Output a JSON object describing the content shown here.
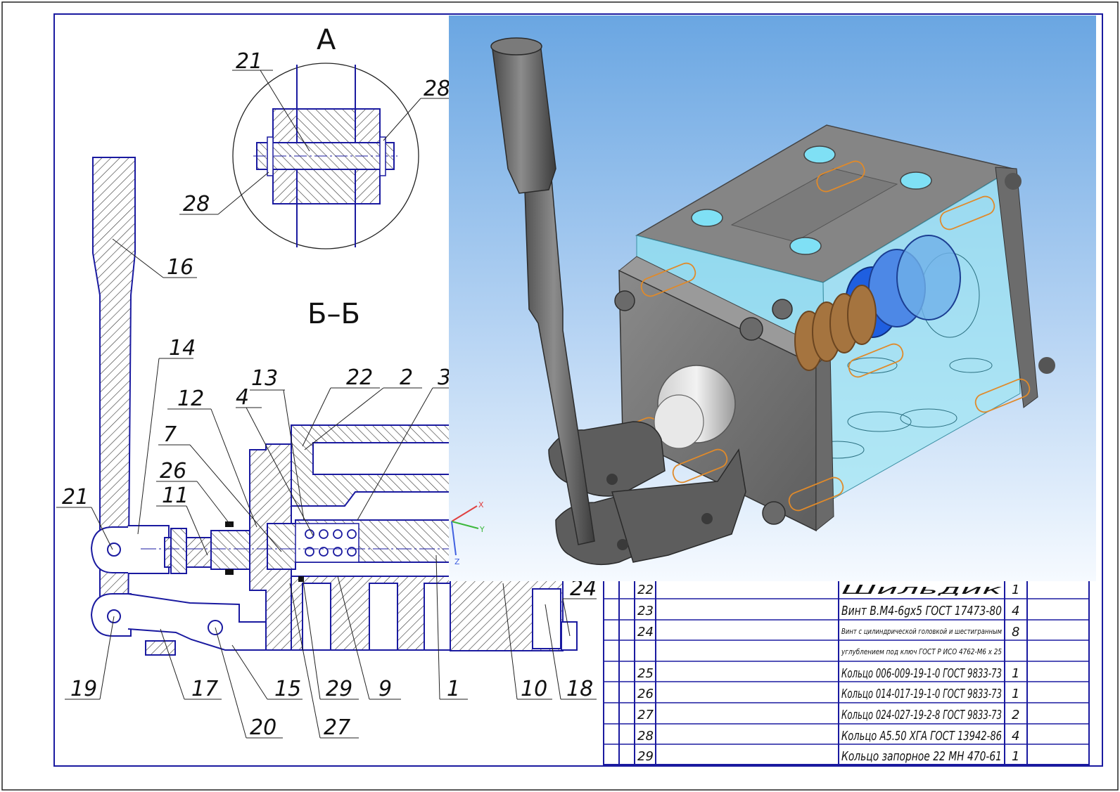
{
  "views": {
    "detail_a": "А",
    "section_bb": "Б–Б"
  },
  "callouts": {
    "n21_top": "21",
    "n28_top": "28",
    "n28_bottom": "28",
    "n16": "16",
    "n14": "14",
    "n13": "13",
    "n22": "22",
    "n2": "2",
    "n3": "3",
    "n12": "12",
    "n4": "4",
    "n7": "7",
    "n26": "26",
    "n11": "11",
    "n21_left": "21",
    "n19": "19",
    "n17": "17",
    "n15": "15",
    "n20": "20",
    "n29": "29",
    "n27": "27",
    "n9": "9",
    "n1": "1",
    "n10": "10",
    "n18": "18",
    "n24": "24"
  },
  "axis_triad": {
    "x": "X",
    "y": "Y",
    "z": "Z"
  },
  "bom": [
    {
      "pos": "22",
      "name": "Шильдик",
      "qty": "1"
    },
    {
      "pos": "23",
      "name": "Винт В.М4-6gx5 ГОСТ 17473-80",
      "qty": "4"
    },
    {
      "pos": "24",
      "name": "Винт с цилиндрической головкой и шестигранным",
      "qty": "8"
    },
    {
      "pos": "",
      "name": "углублением под ключ ГОСТ Р ИСО 4762-М6 х 25",
      "qty": ""
    },
    {
      "pos": "25",
      "name": "Кольцо 006-009-19-1-0 ГОСТ 9833-73",
      "qty": "1"
    },
    {
      "pos": "26",
      "name": "Кольцо 014-017-19-1-0 ГОСТ 9833-73",
      "qty": "1"
    },
    {
      "pos": "27",
      "name": "Кольцо 024-027-19-2-8 ГОСТ 9833-73",
      "qty": "2"
    },
    {
      "pos": "28",
      "name": "Кольцо А5.50 ХГА ГОСТ 13942-86",
      "qty": "4"
    },
    {
      "pos": "29",
      "name": "Кольцо запорное 22 МН 470-61",
      "qty": "1"
    }
  ],
  "colors": {
    "line_blue": "#1a1aa0",
    "hatch": "#333333",
    "render_bg_top": "#6fa8e0",
    "render_bg_bottom": "#f3f8ff",
    "body_grey": "#7a7a7a",
    "transparent_cyan": "#8fdfef",
    "hidden_orange": "#e08a2a",
    "seal_blue": "#1f5fe0"
  }
}
